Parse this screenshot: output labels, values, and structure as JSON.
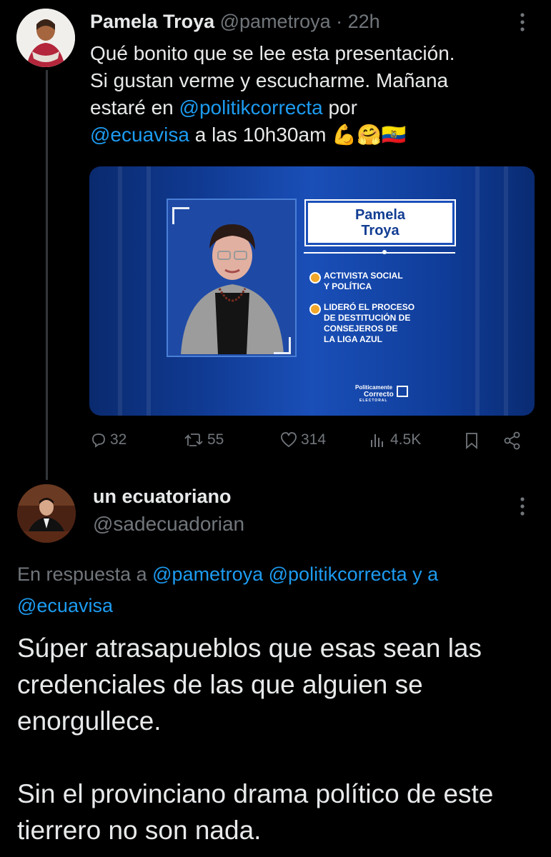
{
  "tweet1": {
    "author_name": "Pamela Troya",
    "handle": "@pametroya",
    "separator": "·",
    "time": "22h",
    "text_line1": "Qué bonito que se lee esta presentación.",
    "text_line2": "Si gustan verme y escucharme. Mañana",
    "text_line3_pre": "estaré en ",
    "mention1": "@politikcorrecta",
    "text_line3_post": " por",
    "mention2": "@ecuavisa",
    "text_line4_post": " a las 10h30am ",
    "emojis": "💪🤗🇪🇨",
    "media": {
      "nameplate_line1": "Pamela",
      "nameplate_line2": "Troya",
      "bullet1": "ACTIVISTA SOCIAL\nY POLÍTICA",
      "bullet2": "LIDERÓ EL PROCESO\nDE DESTITUCIÓN DE\nCONSEJEROS DE\nLA LIGA AZUL",
      "logo_line1": "Politicamente",
      "logo_line2": "Correcto",
      "logo_line3": "ELECTORAL"
    },
    "actions": {
      "replies": "32",
      "reposts": "55",
      "likes": "314",
      "views": "4.5K"
    }
  },
  "tweet2": {
    "author_name": "un ecuatoriano",
    "handle": "@sadecuadorian",
    "reply_prefix": "En respuesta a ",
    "reply_mention1": "@pametroya",
    "reply_mention2": "@politikcorrecta",
    "reply_and": " y a",
    "reply_mention3": "@ecuavisa",
    "paragraph1": "Súper atrasapueblos que esas sean las credenciales de las que alguien se enorgullece.",
    "paragraph2": "Sin el provinciano drama político de este tierrero no son nada."
  },
  "icons": [
    "more-icon",
    "reply-icon",
    "repost-icon",
    "like-icon",
    "views-icon",
    "bookmark-icon",
    "share-icon"
  ],
  "colors": {
    "background": "#000000",
    "text": "#e7e9ea",
    "muted": "#71767b",
    "link": "#1d9bf0",
    "thread_line": "#333639"
  }
}
